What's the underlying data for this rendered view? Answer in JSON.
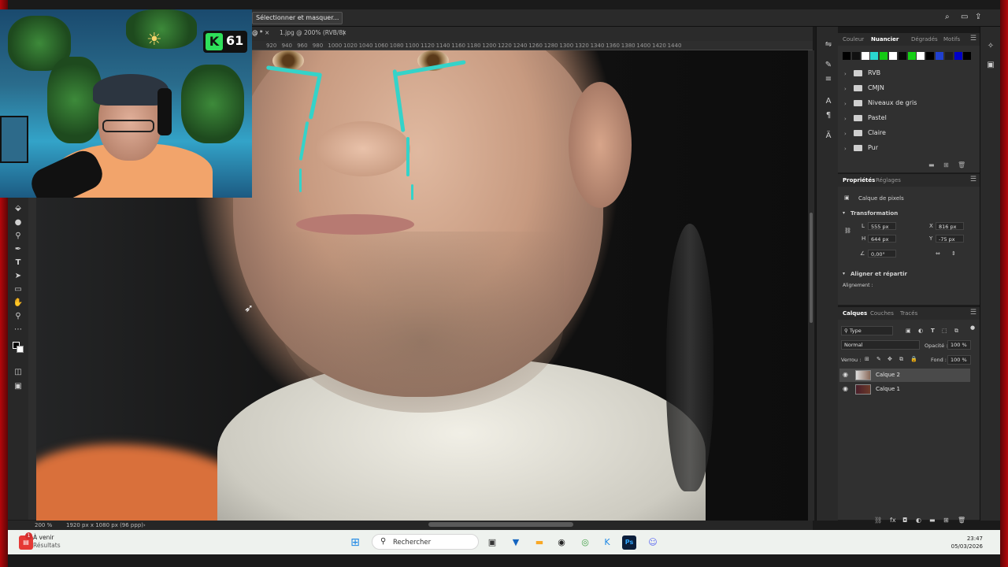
{
  "app": {
    "topbar_button": "Sélectionner et masquer...",
    "doc_tab_active": "@ *",
    "doc_tab_second": "1.jpg @ 200% (RVB/8)",
    "ruler_ticks": [
      "920",
      "940",
      "960",
      "980",
      "1000",
      "1020",
      "1040",
      "1060",
      "1080",
      "1100",
      "1120",
      "1140",
      "1160",
      "1180",
      "1200",
      "1220",
      "1240",
      "1260",
      "1280",
      "1300",
      "1320",
      "1340",
      "1360",
      "1380",
      "1400",
      "1420",
      "1440"
    ]
  },
  "status": {
    "zoom": "200 %",
    "doc_size": "1920 px x 1080 px (96 ppp)"
  },
  "swatches_panel": {
    "tabs": [
      "Couleur",
      "Nuancier",
      "Dégradés",
      "Motifs"
    ],
    "active_tab": "Nuancier",
    "swatch_colors": [
      "#000000",
      "#111111",
      "#ffffff",
      "#2ad8d0",
      "#14c814",
      "#ffffff",
      "#0a0a0a",
      "#15d015",
      "#ffffff",
      "#000000",
      "#2040d0",
      "#1e1e1e",
      "#0000c8",
      "#000000"
    ],
    "groups": [
      "RVB",
      "CMJN",
      "Niveaux de gris",
      "Pastel",
      "Claire",
      "Pur"
    ]
  },
  "properties_panel": {
    "tabs": [
      "Propriétés",
      "Réglages"
    ],
    "active_tab": "Propriétés",
    "layer_kind": "Calque de pixels",
    "transform_title": "Transformation",
    "L_label": "L",
    "L_value": "555 px",
    "H_label": "H",
    "H_value": "644 px",
    "X_label": "X",
    "X_value": "816 px",
    "Y_label": "Y",
    "Y_value": "-75 px",
    "angle_value": "0,00°",
    "align_title": "Aligner et répartir",
    "align_label": "Alignement :"
  },
  "layers_panel": {
    "tabs": [
      "Calques",
      "Couches",
      "Tracés"
    ],
    "active_tab": "Calques",
    "filter_label": "Type",
    "blend_mode": "Normal",
    "opacity_label": "Opacité :",
    "opacity_value": "100 %",
    "lock_label": "Verrou :",
    "fill_label": "Fond :",
    "fill_value": "100 %",
    "layers": [
      {
        "name": "Calque 2",
        "selected": true
      },
      {
        "name": "Calque 1",
        "selected": false
      }
    ]
  },
  "overlay": {
    "badge_letter": "K",
    "badge_number": "61"
  },
  "taskbar": {
    "widget_title": "À venir",
    "widget_sub": "Résultats",
    "widget_badge": "1",
    "search_placeholder": "Rechercher",
    "time": "23:47",
    "date": "05/03/2026"
  }
}
